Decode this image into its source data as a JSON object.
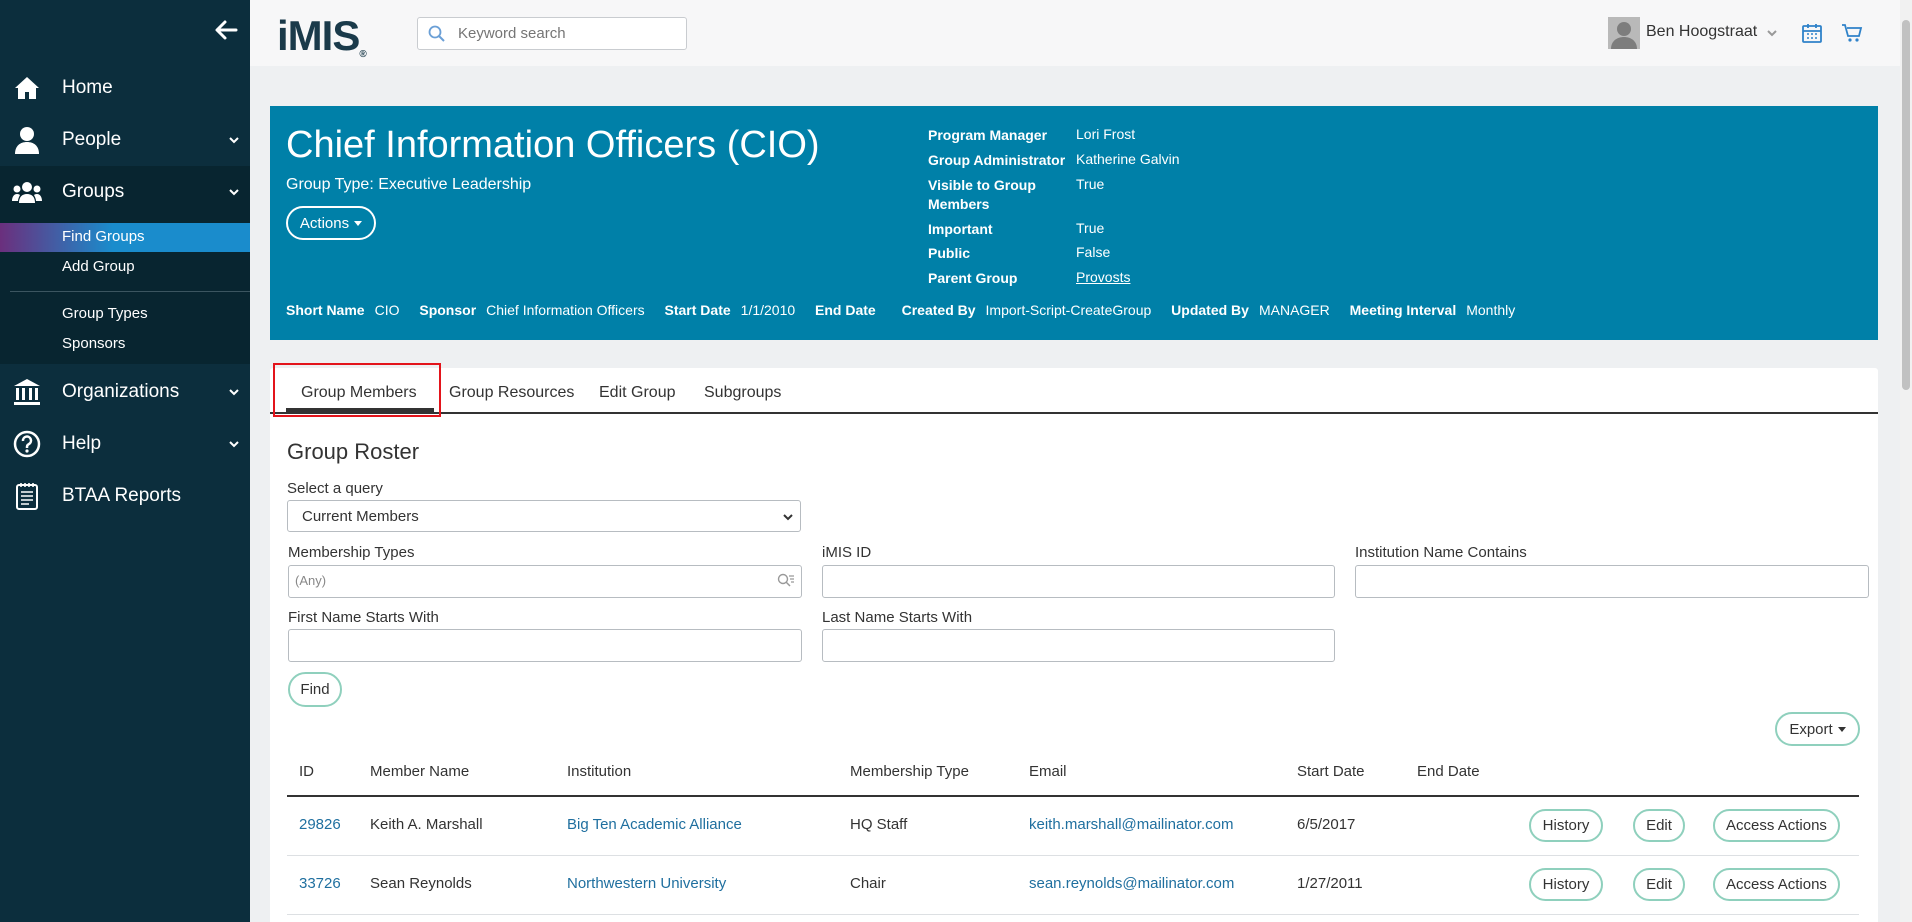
{
  "sidebar": {
    "items": [
      {
        "label": "Home",
        "icon": "home-icon"
      },
      {
        "label": "People",
        "icon": "person-icon"
      },
      {
        "label": "Groups",
        "icon": "groups-icon"
      },
      {
        "label": "Organizations",
        "icon": "building-icon"
      },
      {
        "label": "Help",
        "icon": "help-icon"
      },
      {
        "label": "BTAA Reports",
        "icon": "report-icon"
      }
    ],
    "groups_sub": [
      "Find Groups",
      "Add Group",
      "Group Types",
      "Sponsors"
    ]
  },
  "topbar": {
    "logo": "iMIS",
    "search_placeholder": "Keyword search",
    "user_name": "Ben Hoogstraat"
  },
  "group": {
    "title": "Chief Information Officers (CIO)",
    "type_line": "Group Type: Executive Leadership",
    "actions_label": "Actions",
    "props": [
      {
        "label": "Program Manager",
        "value": "Lori Frost"
      },
      {
        "label": "Group Administrator",
        "value": "Katherine Galvin"
      },
      {
        "label": "Visible to Group Members",
        "value": "True"
      },
      {
        "label": "Important",
        "value": "True"
      },
      {
        "label": "Public",
        "value": "False"
      },
      {
        "label": "Parent Group",
        "value": "Provosts"
      }
    ],
    "meta": [
      {
        "label": "Short Name",
        "value": "CIO"
      },
      {
        "label": "Sponsor",
        "value": "Chief Information Officers"
      },
      {
        "label": "Start Date",
        "value": "1/1/2010"
      },
      {
        "label": "End Date",
        "value": ""
      },
      {
        "label": "Created By",
        "value": "Import-Script-CreateGroup"
      },
      {
        "label": "Updated By",
        "value": "MANAGER"
      },
      {
        "label": "Meeting Interval",
        "value": "Monthly"
      }
    ]
  },
  "tabs": [
    "Group Members",
    "Group Resources",
    "Edit Group",
    "Subgroups"
  ],
  "roster": {
    "title": "Group Roster",
    "query_label": "Select a query",
    "query_value": "Current Members",
    "membership_types_label": "Membership Types",
    "membership_types_placeholder": "(Any)",
    "imis_id_label": "iMIS ID",
    "institution_label": "Institution Name Contains",
    "first_name_label": "First Name Starts With",
    "last_name_label": "Last Name Starts With",
    "find_label": "Find",
    "export_label": "Export",
    "columns": [
      "ID",
      "Member Name",
      "Institution",
      "Membership Type",
      "Email",
      "Start Date",
      "End Date"
    ],
    "rows": [
      {
        "id": "29826",
        "name": "Keith A. Marshall",
        "institution": "Big Ten Academic Alliance",
        "type": "HQ Staff",
        "email": "keith.marshall@mailinator.com",
        "start": "6/5/2017",
        "end": ""
      },
      {
        "id": "33726",
        "name": "Sean Reynolds",
        "institution": "Northwestern University",
        "type": "Chair",
        "email": "sean.reynolds@mailinator.com",
        "start": "1/27/2011",
        "end": ""
      }
    ],
    "row_actions": [
      "History",
      "Edit",
      "Access Actions"
    ]
  }
}
